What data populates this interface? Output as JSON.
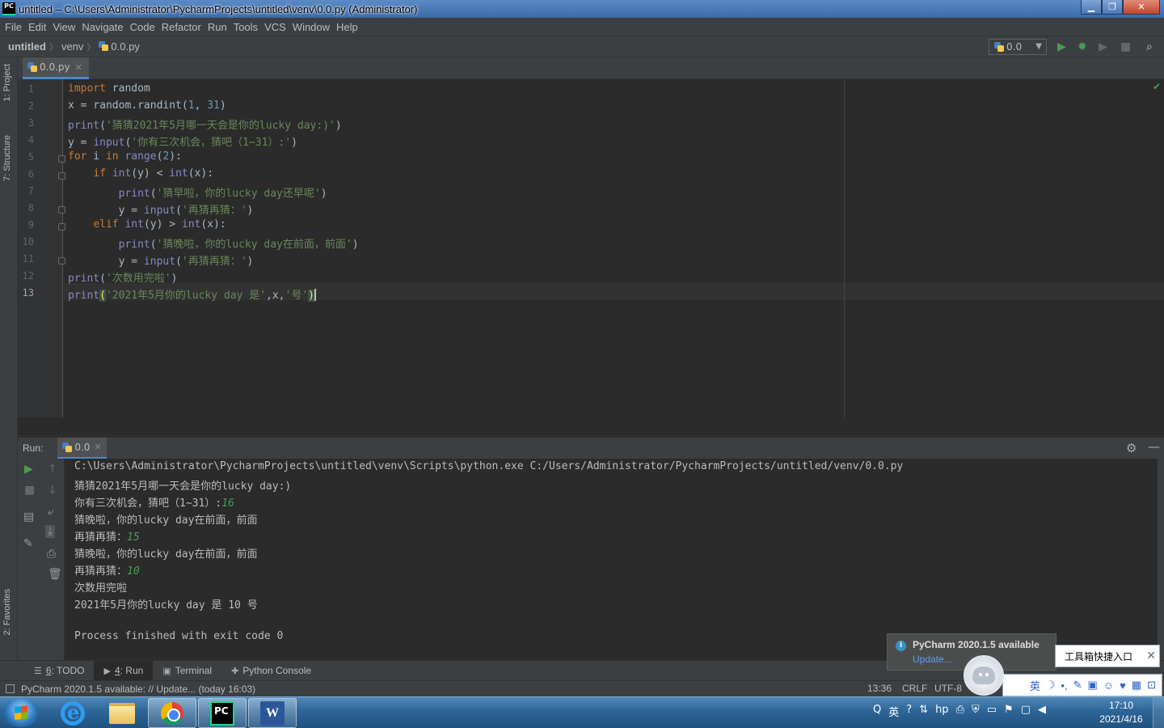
{
  "window": {
    "title": "untitled – C:\\Users\\Administrator\\PycharmProjects\\untitled\\venv\\0.0.py (Administrator)",
    "app_icon_text": "PC"
  },
  "menu": [
    "File",
    "Edit",
    "View",
    "Navigate",
    "Code",
    "Refactor",
    "Run",
    "Tools",
    "VCS",
    "Window",
    "Help"
  ],
  "breadcrumb": {
    "project": "untitled",
    "folder": "venv",
    "file": "0.0.py"
  },
  "run_config": {
    "name": "0.0"
  },
  "side_tabs": {
    "project": "1: Project",
    "structure": "7: Structure",
    "favorites": "2: Favorites"
  },
  "editor": {
    "tab_label": "0.0.py",
    "line_numbers": [
      "1",
      "2",
      "3",
      "4",
      "5",
      "6",
      "7",
      "8",
      "9",
      "10",
      "11",
      "12",
      "13"
    ],
    "current_line": 13
  },
  "code_lines": [
    [
      {
        "t": "import",
        "c": "kw"
      },
      {
        "t": " random"
      }
    ],
    [
      {
        "t": "x = random.randint("
      },
      {
        "t": "1",
        "c": "num"
      },
      {
        "t": ", "
      },
      {
        "t": "31",
        "c": "num"
      },
      {
        "t": ")"
      }
    ],
    [
      {
        "t": "print",
        "c": "fn"
      },
      {
        "t": "("
      },
      {
        "t": "'猜猜2021年5月哪一天会是你的lucky day:)'",
        "c": "str"
      },
      {
        "t": ")"
      }
    ],
    [
      {
        "t": "y = "
      },
      {
        "t": "input",
        "c": "fn"
      },
      {
        "t": "("
      },
      {
        "t": "'你有三次机会，猜吧（1~31）:'",
        "c": "str"
      },
      {
        "t": ")"
      }
    ],
    [
      {
        "t": "for",
        "c": "kw"
      },
      {
        "t": " i "
      },
      {
        "t": "in",
        "c": "kw"
      },
      {
        "t": " "
      },
      {
        "t": "range",
        "c": "fn"
      },
      {
        "t": "("
      },
      {
        "t": "2",
        "c": "num"
      },
      {
        "t": "):"
      }
    ],
    [
      {
        "t": "    "
      },
      {
        "t": "if",
        "c": "kw"
      },
      {
        "t": " "
      },
      {
        "t": "int",
        "c": "fn"
      },
      {
        "t": "(y) < "
      },
      {
        "t": "int",
        "c": "fn"
      },
      {
        "t": "(x):"
      }
    ],
    [
      {
        "t": "        "
      },
      {
        "t": "print",
        "c": "fn"
      },
      {
        "t": "("
      },
      {
        "t": "'猜早啦，你的lucky day还早呢'",
        "c": "str"
      },
      {
        "t": ")"
      }
    ],
    [
      {
        "t": "        y = "
      },
      {
        "t": "input",
        "c": "fn"
      },
      {
        "t": "("
      },
      {
        "t": "'再猜再猜：'",
        "c": "str"
      },
      {
        "t": ")"
      }
    ],
    [
      {
        "t": "    "
      },
      {
        "t": "elif",
        "c": "kw"
      },
      {
        "t": " "
      },
      {
        "t": "int",
        "c": "fn"
      },
      {
        "t": "(y) > "
      },
      {
        "t": "int",
        "c": "fn"
      },
      {
        "t": "(x):"
      }
    ],
    [
      {
        "t": "        "
      },
      {
        "t": "print",
        "c": "fn"
      },
      {
        "t": "("
      },
      {
        "t": "'猜晚啦，你的lucky day在前面，前面'",
        "c": "str"
      },
      {
        "t": ")"
      }
    ],
    [
      {
        "t": "        y = "
      },
      {
        "t": "input",
        "c": "fn"
      },
      {
        "t": "("
      },
      {
        "t": "'再猜再猜：'",
        "c": "str"
      },
      {
        "t": ")"
      }
    ],
    [
      {
        "t": "print",
        "c": "fn"
      },
      {
        "t": "("
      },
      {
        "t": "'次数用完啦'",
        "c": "str"
      },
      {
        "t": ")"
      }
    ],
    [
      {
        "t": "print",
        "c": "fn"
      },
      {
        "t": "(",
        "c": "br"
      },
      {
        "t": "'2021年5月你的lucky day 是'",
        "c": "str"
      },
      {
        "t": ",x,"
      },
      {
        "t": "'号'",
        "c": "str"
      },
      {
        "t": ")",
        "c": "br"
      }
    ]
  ],
  "run_panel": {
    "label": "Run:",
    "tab": "0.0",
    "console": [
      [
        {
          "t": "C:\\Users\\Administrator\\PycharmProjects\\untitled\\venv\\Scripts\\python.exe C:/Users/Administrator/PycharmProjects/untitled/venv/0.0.py"
        }
      ],
      [
        {
          "t": "猜猜2021年5月哪一天会是你的lucky day:)"
        }
      ],
      [
        {
          "t": "你有三次机会，猜吧（1~31）:"
        },
        {
          "t": "16",
          "c": "uin"
        }
      ],
      [
        {
          "t": "猜晚啦，你的lucky day在前面，前面"
        }
      ],
      [
        {
          "t": "再猜再猜："
        },
        {
          "t": "15",
          "c": "uin"
        }
      ],
      [
        {
          "t": "猜晚啦，你的lucky day在前面，前面"
        }
      ],
      [
        {
          "t": "再猜再猜："
        },
        {
          "t": "10",
          "c": "uin"
        }
      ],
      [
        {
          "t": "次数用完啦"
        }
      ],
      [
        {
          "t": "2021年5月你的lucky day 是 10 号"
        }
      ],
      [
        {
          "t": ""
        }
      ],
      [
        {
          "t": "Process finished with exit code 0"
        }
      ]
    ]
  },
  "tool_tabs": [
    {
      "mnemonic": "6",
      "label": ": TODO",
      "icon": "todo-icon",
      "active": false
    },
    {
      "mnemonic": "4",
      "label": ": Run",
      "icon": "run-icon",
      "active": true
    },
    {
      "mnemonic": "",
      "label": "Terminal",
      "icon": "terminal-icon",
      "active": false
    },
    {
      "mnemonic": "",
      "label": "Python Console",
      "icon": "python-console-icon",
      "active": false
    }
  ],
  "status": {
    "message": "PyCharm 2020.1.5 available: // Update... (today 16:03)",
    "position": "13:36",
    "line_sep": "CRLF",
    "encoding": "UTF-8"
  },
  "notification": {
    "title": "PyCharm 2020.1.5 available",
    "link": "Update..."
  },
  "ime": {
    "tip": "工具箱快捷入口",
    "lang": "英"
  },
  "taskbar": {
    "apps": [
      "internet-explorer-icon",
      "file-explorer-icon",
      "chrome-icon",
      "pycharm-icon",
      "word-icon"
    ],
    "tray_lang": "英",
    "time": "17:10",
    "date": "2021/4/16"
  }
}
